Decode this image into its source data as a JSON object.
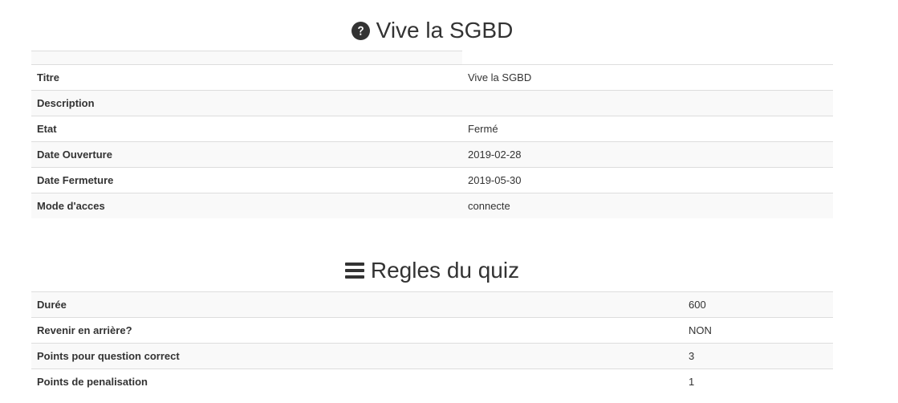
{
  "info": {
    "title": "Vive la SGBD",
    "icon": "question-circle-icon",
    "rows": [
      {
        "label": "Titre",
        "value": "Vive la SGBD"
      },
      {
        "label": "Description",
        "value": ""
      },
      {
        "label": "Etat",
        "value": "Fermé"
      },
      {
        "label": "Date Ouverture",
        "value": "2019-02-28"
      },
      {
        "label": "Date Fermeture",
        "value": "2019-05-30"
      },
      {
        "label": "Mode d'acces",
        "value": "connecte"
      }
    ]
  },
  "rules": {
    "title": "Regles du quiz",
    "icon": "list-icon",
    "rows": [
      {
        "label": "Durée",
        "value": "600"
      },
      {
        "label": "Revenir en arrière?",
        "value": "NON"
      },
      {
        "label": "Points pour question correct",
        "value": "3"
      },
      {
        "label": "Points de penalisation",
        "value": "1"
      }
    ]
  }
}
